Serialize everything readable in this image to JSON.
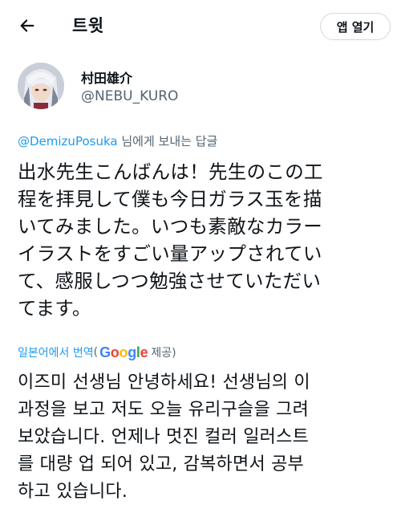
{
  "header": {
    "title": "트윗",
    "open_app_label": "앱 열기"
  },
  "tweet": {
    "display_name": "村田雄介",
    "handle": "@NEBU_KURO",
    "reply_to_mention": "@DemizuPosuka",
    "reply_suffix": " 님에게 보내는 답글",
    "text": "出水先生こんばんは！先生のこの工\n程を拝見して僕も今日ガラス玉を描\nいてみました。いつも素敵なカラー\nイラストをすごい量アップされてい\nて、感服しつつ勉強させていただい\nてます。"
  },
  "translation": {
    "label": "일본어에서 번역",
    "paren_open": "(",
    "provider": "Google",
    "suffix": " 제공)",
    "text": "이즈미 선생님 안녕하세요! 선생님의 이\n과정을 보고 저도 오늘 유리구슬을 그려\n보았습니다. 언제나 멋진 컬러 일러스트\n를 대량 업 되어 있고, 감복하면서 공부\n하고 있습니다."
  },
  "colors": {
    "link": "#1d9bf0",
    "secondary_text": "#536471",
    "google_blue": "#4285F4",
    "google_red": "#EA4335",
    "google_yellow": "#FBBC05",
    "google_green": "#34A853"
  }
}
